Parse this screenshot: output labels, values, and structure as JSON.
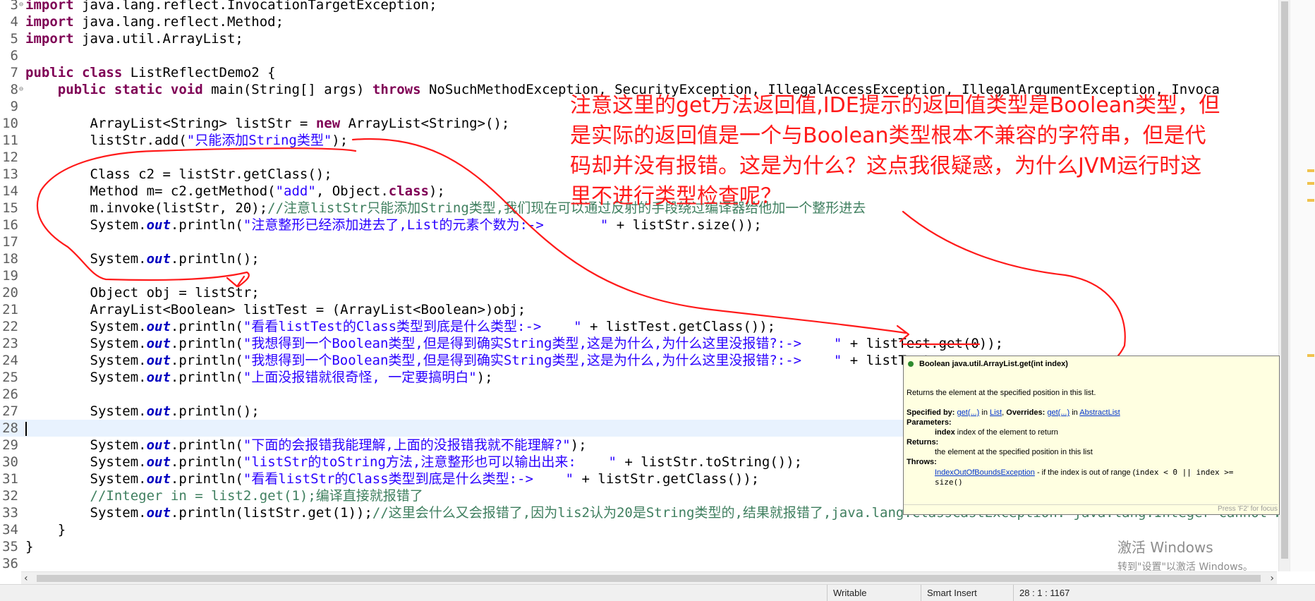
{
  "code_lines": [
    {
      "n": "3",
      "fold": true,
      "tokens": [
        [
          "kw",
          "import"
        ],
        [
          "t",
          " java.lang.reflect.InvocationTargetException;"
        ]
      ]
    },
    {
      "n": "4",
      "tokens": [
        [
          "kw",
          "import"
        ],
        [
          "t",
          " java.lang.reflect.Method;"
        ]
      ]
    },
    {
      "n": "5",
      "tokens": [
        [
          "kw",
          "import"
        ],
        [
          "t",
          " java.util.ArrayList;"
        ]
      ]
    },
    {
      "n": "6",
      "tokens": []
    },
    {
      "n": "7",
      "tokens": [
        [
          "kw",
          "public class"
        ],
        [
          "t",
          " ListReflectDemo2 {"
        ]
      ]
    },
    {
      "n": "8",
      "fold": true,
      "tokens": [
        [
          "t",
          "    "
        ],
        [
          "kw",
          "public static void"
        ],
        [
          "t",
          " main(String[] args) "
        ],
        [
          "kw",
          "throws"
        ],
        [
          "t",
          " NoSuchMethodException, SecurityException, IllegalAccessException, IllegalArgumentException, Invoca"
        ]
      ]
    },
    {
      "n": "9",
      "tokens": []
    },
    {
      "n": "10",
      "tokens": [
        [
          "t",
          "        ArrayList<String> listStr = "
        ],
        [
          "kw",
          "new"
        ],
        [
          "t",
          " ArrayList<String>();"
        ]
      ]
    },
    {
      "n": "11",
      "tokens": [
        [
          "t",
          "        listStr.add("
        ],
        [
          "str",
          "\"只能添加String类型\""
        ],
        [
          "t",
          ");"
        ]
      ]
    },
    {
      "n": "12",
      "tokens": []
    },
    {
      "n": "13",
      "tokens": [
        [
          "t",
          "        Class c2 = listStr.getClass();"
        ]
      ]
    },
    {
      "n": "14",
      "tokens": [
        [
          "t",
          "        Method m= c2.getMethod("
        ],
        [
          "str",
          "\"add\""
        ],
        [
          "t",
          ", Object."
        ],
        [
          "kw",
          "class"
        ],
        [
          "t",
          ");"
        ]
      ]
    },
    {
      "n": "15",
      "tokens": [
        [
          "t",
          "        m.invoke(listStr, 20);"
        ],
        [
          "cm",
          "//注意listStr只能添加String类型,我们现在可以通过反射的手段绕过编译器给他加一个整形进去"
        ]
      ]
    },
    {
      "n": "16",
      "tokens": [
        [
          "t",
          "        System."
        ],
        [
          "fld",
          "out"
        ],
        [
          "t",
          ".println("
        ],
        [
          "str",
          "\"注意整形已经添加进去了,List的元素个数为:->       \""
        ],
        [
          "t",
          " + listStr.size());"
        ]
      ]
    },
    {
      "n": "17",
      "tokens": []
    },
    {
      "n": "18",
      "tokens": [
        [
          "t",
          "        System."
        ],
        [
          "fld",
          "out"
        ],
        [
          "t",
          ".println();"
        ]
      ]
    },
    {
      "n": "19",
      "tokens": []
    },
    {
      "n": "20",
      "tokens": [
        [
          "t",
          "        Object obj = listStr;"
        ]
      ]
    },
    {
      "n": "21",
      "tokens": [
        [
          "t",
          "        ArrayList<Boolean> listTest = (ArrayList<Boolean>)obj;"
        ]
      ]
    },
    {
      "n": "22",
      "tokens": [
        [
          "t",
          "        System."
        ],
        [
          "fld",
          "out"
        ],
        [
          "t",
          ".println("
        ],
        [
          "str",
          "\"看看listTest的Class类型到底是什么类型:->    \""
        ],
        [
          "t",
          " + listTest.getClass());"
        ]
      ]
    },
    {
      "n": "23",
      "tokens": [
        [
          "t",
          "        System."
        ],
        [
          "fld",
          "out"
        ],
        [
          "t",
          ".println("
        ],
        [
          "str",
          "\"我想得到一个Boolean类型,但是得到确实String类型,这是为什么,为什么这里没报错?:->    \""
        ],
        [
          "t",
          " + listTest.get(0));"
        ]
      ]
    },
    {
      "n": "24",
      "tokens": [
        [
          "t",
          "        System."
        ],
        [
          "fld",
          "out"
        ],
        [
          "t",
          ".println("
        ],
        [
          "str",
          "\"我想得到一个Boolean类型,但是得到确实String类型,这是为什么,为什么这里没报错?:->    \""
        ],
        [
          "t",
          " + listTest."
        ]
      ]
    },
    {
      "n": "25",
      "tokens": [
        [
          "t",
          "        System."
        ],
        [
          "fld",
          "out"
        ],
        [
          "t",
          ".println("
        ],
        [
          "str",
          "\"上面没报错就很奇怪, 一定要搞明白\""
        ],
        [
          "t",
          ");"
        ]
      ]
    },
    {
      "n": "26",
      "tokens": []
    },
    {
      "n": "27",
      "tokens": [
        [
          "t",
          "        System."
        ],
        [
          "fld",
          "out"
        ],
        [
          "t",
          ".println();"
        ]
      ]
    },
    {
      "n": "28",
      "current": true,
      "tokens": []
    },
    {
      "n": "29",
      "tokens": [
        [
          "t",
          "        System."
        ],
        [
          "fld",
          "out"
        ],
        [
          "t",
          ".println("
        ],
        [
          "str",
          "\"下面的会报错我能理解,上面的没报错我就不能理解?\""
        ],
        [
          "t",
          ");"
        ]
      ]
    },
    {
      "n": "30",
      "tokens": [
        [
          "t",
          "        System."
        ],
        [
          "fld",
          "out"
        ],
        [
          "t",
          ".println("
        ],
        [
          "str",
          "\"listStr的toString方法,注意整形也可以输出出来:    \""
        ],
        [
          "t",
          " + listStr.toString());"
        ]
      ]
    },
    {
      "n": "31",
      "tokens": [
        [
          "t",
          "        System."
        ],
        [
          "fld",
          "out"
        ],
        [
          "t",
          ".println("
        ],
        [
          "str",
          "\"看看listStr的Class类型到底是什么类型:->    \""
        ],
        [
          "t",
          " + listStr.getClass());"
        ]
      ]
    },
    {
      "n": "32",
      "tokens": [
        [
          "cm",
          "        //Integer in = list2.get(1);编译直接就报错了"
        ]
      ]
    },
    {
      "n": "33",
      "tokens": [
        [
          "t",
          "        System."
        ],
        [
          "fld",
          "out"
        ],
        [
          "t",
          ".println(listStr.get(1));"
        ],
        [
          "cm",
          "//这里会什么又会报错了,因为lis2认为20是String类型的,结果就报错了,java.lang.ClassCastException: java.lang.Integer cannot b"
        ]
      ]
    },
    {
      "n": "34",
      "tokens": [
        [
          "t",
          "    }"
        ]
      ]
    },
    {
      "n": "35",
      "tokens": [
        [
          "t",
          "}"
        ]
      ]
    },
    {
      "n": "36",
      "tokens": []
    }
  ],
  "annotation": "注意这里的get方法返回值,IDE提示的返回值类型是Boolean类型，但\n是实际的返回值是一个与Boolean类型根本不兼容的字符串，但是代\n码却并没有报错。这是为什么？这点我很疑惑，为什么JVM运行时这\n里不进行类型检查呢？",
  "tooltip": {
    "signature": "Boolean java.util.ArrayList.get(int index)",
    "description": "Returns the element at the specified position in this list.",
    "specified_by_label": "Specified by:",
    "specified_by_link": "get(...)",
    "in_word": "in",
    "list_link": "List",
    "overrides_label": "Overrides:",
    "overrides_link": "get(...)",
    "abstract_link": "AbstractList",
    "parameters_label": "Parameters:",
    "param_name": "index",
    "param_desc": "index of the element to return",
    "returns_label": "Returns:",
    "returns_desc": "the element at the specified position in this list",
    "throws_label": "Throws:",
    "throws_link": "IndexOutOfBoundsException",
    "throws_desc": "- if the index is out of range (",
    "throws_code": "index < 0 || index >=",
    "throws_code2": "size()",
    "hint": "Press 'F2' for focus"
  },
  "status": {
    "writable": "Writable",
    "insert_mode": "Smart Insert",
    "position": "28 : 1 : 1167"
  },
  "watermark": {
    "line1": "激活 Windows",
    "line2": "转到\"设置\"以激活 Windows。"
  },
  "colors": {
    "keyword": "#7f0055",
    "string": "#2a00ff",
    "comment": "#3f7f5f",
    "field": "#0000c0",
    "annotation": "#ff1a1a",
    "tooltip_bg": "#ffffe1"
  }
}
